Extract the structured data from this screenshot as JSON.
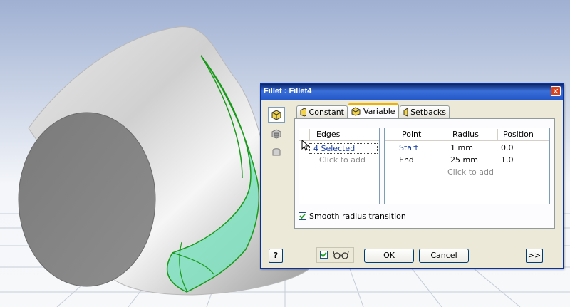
{
  "dialog": {
    "title": "Fillet : Fillet4",
    "close_glyph": "✕",
    "tabs": [
      {
        "label": "Constant",
        "icon": "constant-fillet-icon"
      },
      {
        "label": "Variable",
        "icon": "variable-fillet-icon",
        "active": true
      },
      {
        "label": "Setbacks",
        "icon": "setbacks-icon"
      }
    ],
    "side_buttons": [
      "edge-fillet-icon",
      "face-fillet-icon",
      "full-round-fillet-icon"
    ],
    "edges": {
      "header": "Edges",
      "rows": [
        "4 Selected"
      ],
      "placeholder": "Click to add"
    },
    "points": {
      "columns": [
        "Point",
        "Radius",
        "Position"
      ],
      "rows": [
        {
          "point": "Start",
          "radius": "1 mm",
          "position": "0.0"
        },
        {
          "point": "End",
          "radius": "25 mm",
          "position": "1.0"
        }
      ],
      "placeholder": "Click to add"
    },
    "smooth_transition": {
      "label": "Smooth radius transition",
      "checked": true
    },
    "buttons": {
      "ok": "OK",
      "cancel": "Cancel",
      "more": ">>",
      "help": "?"
    },
    "preview_checked": true
  },
  "colors": {
    "title_bar": "#0a246a",
    "tab_highlight": "#f0b000",
    "fillet_preview": "#7fe0c0",
    "edge_highlight": "#1a9a1a"
  }
}
